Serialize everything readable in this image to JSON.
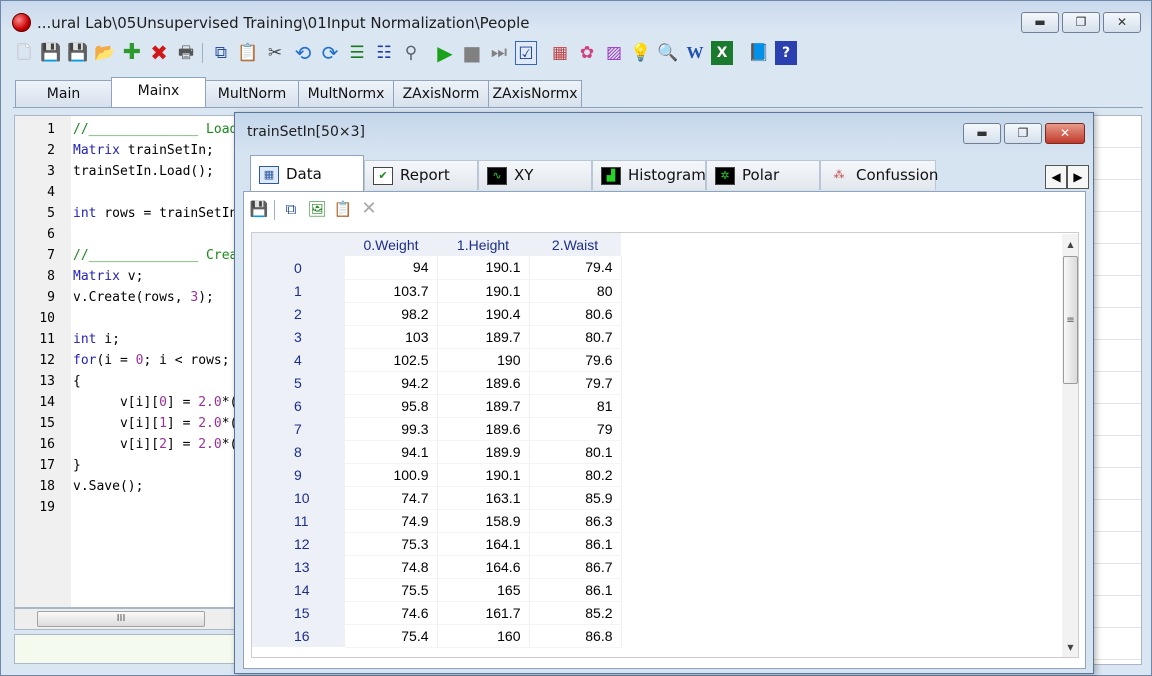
{
  "window": {
    "title": "...ural Lab\\05Unsupervised Training\\01Input Normalization\\People",
    "minimize": "▬",
    "maximize": "❐",
    "close": "✕"
  },
  "toolbar": {
    "icons": [
      "new-file-icon",
      "save-icon",
      "save-as-icon",
      "open-folder-icon",
      "add-icon",
      "delete-icon",
      "print-icon",
      "copy-icon",
      "paste-icon",
      "cut-icon",
      "undo-icon",
      "redo-icon",
      "align-icon",
      "indent-icon",
      "find-icon",
      "run-icon",
      "stop-icon",
      "step-icon",
      "check-icon",
      "chart-icon",
      "colors-icon",
      "palette-icon",
      "bulb-icon",
      "preview-icon",
      "word-icon",
      "excel-icon",
      "book-icon",
      "help-icon"
    ]
  },
  "main_tabs": [
    "Main",
    "Mainx",
    "MultNorm",
    "MultNormx",
    "ZAxisNorm",
    "ZAxisNormx"
  ],
  "editor": {
    "line_numbers": [
      "1",
      "2",
      "3",
      "4",
      "5",
      "6",
      "7",
      "8",
      "9",
      "10",
      "11",
      "12",
      "13",
      "14",
      "15",
      "16",
      "17",
      "18",
      "19"
    ],
    "lines": [
      [
        {
          "t": "//______________ Load t",
          "c": "cm"
        }
      ],
      [
        {
          "t": "Matrix",
          "c": "kw"
        },
        {
          "t": " trainSetIn;",
          "c": ""
        }
      ],
      [
        {
          "t": "trainSetIn.Load();",
          "c": ""
        }
      ],
      [],
      [
        {
          "t": "int",
          "c": "kw"
        },
        {
          "t": " rows = trainSetIn.Get",
          "c": ""
        }
      ],
      [],
      [
        {
          "t": "//______________ Create",
          "c": "cm"
        }
      ],
      [
        {
          "t": "Matrix",
          "c": "kw"
        },
        {
          "t": " v;",
          "c": ""
        }
      ],
      [
        {
          "t": "v.Create(rows, ",
          "c": ""
        },
        {
          "t": "3",
          "c": "num"
        },
        {
          "t": ");",
          "c": ""
        }
      ],
      [],
      [
        {
          "t": "int",
          "c": "kw"
        },
        {
          "t": " i;",
          "c": ""
        }
      ],
      [
        {
          "t": "for",
          "c": "kw"
        },
        {
          "t": "(i = ",
          "c": ""
        },
        {
          "t": "0",
          "c": "num"
        },
        {
          "t": "; i < rows; i++)",
          "c": ""
        }
      ],
      [
        {
          "t": "{",
          "c": ""
        }
      ],
      [
        {
          "t": "      v[i][",
          "c": ""
        },
        {
          "t": "0",
          "c": "num"
        },
        {
          "t": "] = ",
          "c": ""
        },
        {
          "t": "2.0",
          "c": "num"
        },
        {
          "t": "*(trai",
          "c": ""
        }
      ],
      [
        {
          "t": "      v[i][",
          "c": ""
        },
        {
          "t": "1",
          "c": "num"
        },
        {
          "t": "] = ",
          "c": ""
        },
        {
          "t": "2.0",
          "c": "num"
        },
        {
          "t": "*(trai",
          "c": ""
        }
      ],
      [
        {
          "t": "      v[i][",
          "c": ""
        },
        {
          "t": "2",
          "c": "num"
        },
        {
          "t": "] = ",
          "c": ""
        },
        {
          "t": "2.0",
          "c": "num"
        },
        {
          "t": "*(trai",
          "c": ""
        }
      ],
      [
        {
          "t": "}",
          "c": ""
        }
      ],
      [
        {
          "t": "v.Save();",
          "c": ""
        }
      ],
      []
    ],
    "hscroll_grip": "III"
  },
  "child": {
    "title": "trainSetIn[50×3]",
    "minimize": "▬",
    "maximize": "❐",
    "close": "✕",
    "tabs": [
      {
        "label": "Data",
        "icon": "table-icon"
      },
      {
        "label": "Report",
        "icon": "checkbox-icon"
      },
      {
        "label": "XY",
        "icon": "wave-icon"
      },
      {
        "label": "Histogram",
        "icon": "histogram-icon"
      },
      {
        "label": "Polar",
        "icon": "polar-icon"
      },
      {
        "label": "Confussion",
        "icon": "confusion-icon"
      }
    ],
    "nav_left": "◀",
    "nav_right": "▶",
    "grid": {
      "columns": [
        "0.Weight",
        "1.Height",
        "2.Waist"
      ],
      "rows": [
        [
          "0",
          "94",
          "190.1",
          "79.4"
        ],
        [
          "1",
          "103.7",
          "190.1",
          "80"
        ],
        [
          "2",
          "98.2",
          "190.4",
          "80.6"
        ],
        [
          "3",
          "103",
          "189.7",
          "80.7"
        ],
        [
          "4",
          "102.5",
          "190",
          "79.6"
        ],
        [
          "5",
          "94.2",
          "189.6",
          "79.7"
        ],
        [
          "6",
          "95.8",
          "189.7",
          "81"
        ],
        [
          "7",
          "99.3",
          "189.6",
          "79"
        ],
        [
          "8",
          "94.1",
          "189.9",
          "80.1"
        ],
        [
          "9",
          "100.9",
          "190.1",
          "80.2"
        ],
        [
          "10",
          "74.7",
          "163.1",
          "85.9"
        ],
        [
          "11",
          "74.9",
          "158.9",
          "86.3"
        ],
        [
          "12",
          "75.3",
          "164.1",
          "86.1"
        ],
        [
          "13",
          "74.8",
          "164.6",
          "86.7"
        ],
        [
          "14",
          "75.5",
          "165",
          "86.1"
        ],
        [
          "15",
          "74.6",
          "161.7",
          "85.2"
        ],
        [
          "16",
          "75.4",
          "160",
          "86.8"
        ]
      ],
      "scroll_grip": "≡",
      "scroll_up": "▲",
      "scroll_down": "▼"
    }
  }
}
